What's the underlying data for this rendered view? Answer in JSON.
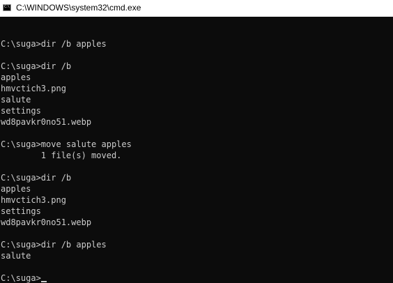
{
  "window": {
    "title": "C:\\WINDOWS\\system32\\cmd.exe",
    "icon": "cmd-app-icon",
    "icon_glyph": "C:\\"
  },
  "console": {
    "lines": [
      "",
      "C:\\suga>dir /b apples",
      "",
      "C:\\suga>dir /b",
      "apples",
      "hmvctich3.png",
      "salute",
      "settings",
      "wd8pavkr0no51.webp",
      "",
      "C:\\suga>move salute apples",
      "        1 file(s) moved.",
      "",
      "C:\\suga>dir /b",
      "apples",
      "hmvctich3.png",
      "settings",
      "wd8pavkr0no51.webp",
      "",
      "C:\\suga>dir /b apples",
      "salute",
      ""
    ],
    "current_prompt": "C:\\suga>"
  },
  "colors": {
    "background": "#0c0c0c",
    "foreground": "#cccccc",
    "titlebar": "#ffffff"
  }
}
